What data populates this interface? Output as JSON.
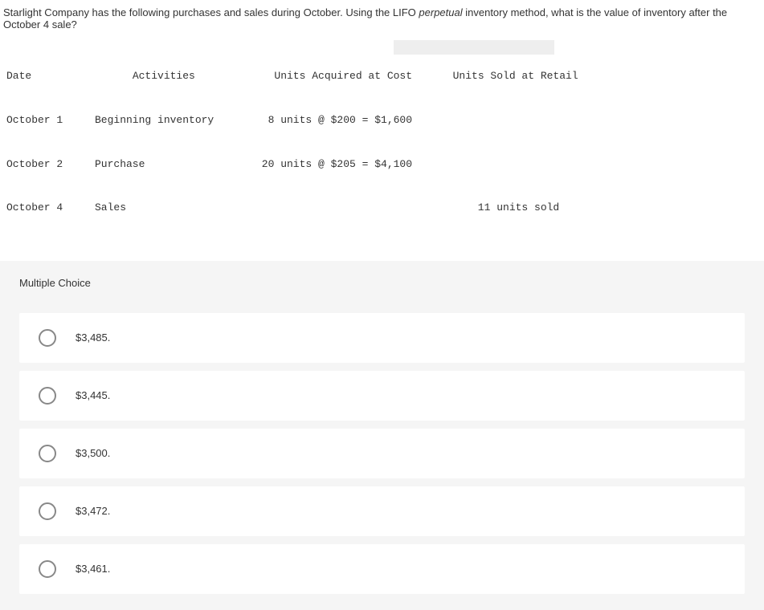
{
  "question": {
    "prefix": "Starlight Company has the following purchases and sales during October. Using the LIFO ",
    "italic": "perpetual",
    "suffix": " inventory method, what is the value of inventory after the October 4 sale?"
  },
  "table": {
    "headers": {
      "date": "Date",
      "activities": "Activities",
      "units_cost": "Units Acquired at Cost",
      "units_sold": "Units Sold at Retail"
    },
    "rows": [
      {
        "date": "October 1",
        "activities": "Beginning inventory",
        "units_cost": "  8 units @ $200 = $1,600",
        "units_sold": ""
      },
      {
        "date": "October 2",
        "activities": "Purchase",
        "units_cost": " 20 units @ $205 = $4,100",
        "units_sold": ""
      },
      {
        "date": "October 4",
        "activities": "Sales",
        "units_cost": "",
        "units_sold": "      11 units sold"
      }
    ]
  },
  "mc_label": "Multiple Choice",
  "options": [
    {
      "label": "$3,485."
    },
    {
      "label": "$3,445."
    },
    {
      "label": "$3,500."
    },
    {
      "label": "$3,472."
    },
    {
      "label": "$3,461."
    }
  ]
}
